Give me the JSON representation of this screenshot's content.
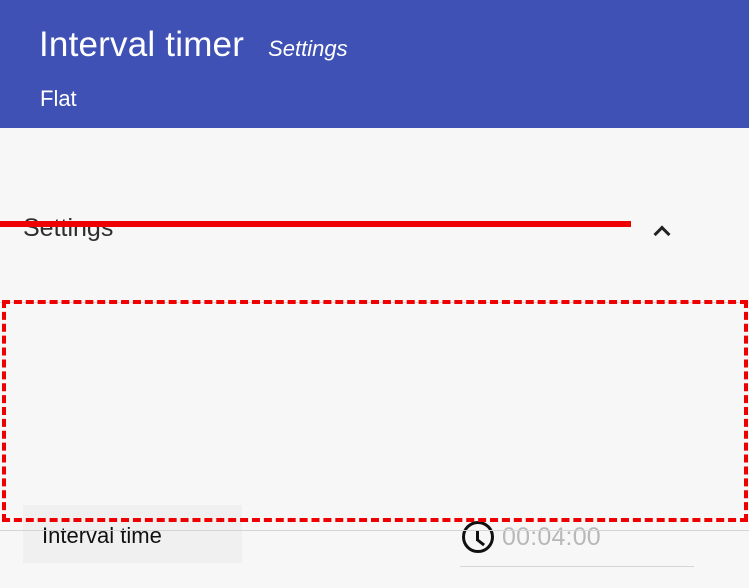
{
  "header": {
    "title": "Interval timer",
    "subtitle": "Settings",
    "mode": "Flat",
    "background_color": "#3f51b5"
  },
  "section": {
    "title": "Settings",
    "toggle_icon": "chevron-up-icon"
  },
  "settings": {
    "interval_time": {
      "label": "Interval time",
      "icon": "clock-icon",
      "value": "00:04:00"
    }
  },
  "annotations": {
    "strike_color": "#ee0000",
    "highlight_color": "#ee0000"
  }
}
